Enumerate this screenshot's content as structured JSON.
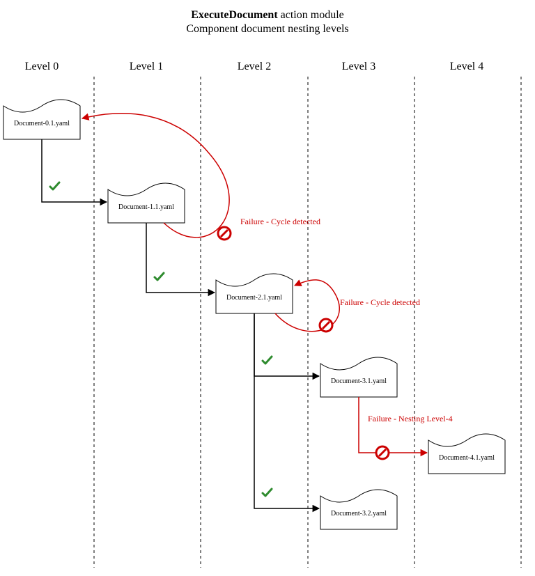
{
  "header": {
    "title_bold": "ExecuteDocument",
    "title_rest": " action module",
    "subtitle": "Component document nesting levels"
  },
  "levels": {
    "l0": "Level 0",
    "l1": "Level 1",
    "l2": "Level 2",
    "l3": "Level 3",
    "l4": "Level 4"
  },
  "docs": {
    "d01": "Document-0.1.yaml",
    "d11": "Document-1.1.yaml",
    "d21": "Document-2.1.yaml",
    "d31": "Document-3.1.yaml",
    "d32": "Document-3.2.yaml",
    "d41": "Document-4.1.yaml"
  },
  "failures": {
    "cycle1": "Failure - Cycle detected",
    "cycle2": "Failure - Cycle detected",
    "nesting4": "Failure - Nesting Level-4"
  },
  "icons": {
    "check": "check-icon",
    "noentry": "no-entry-icon"
  },
  "colors": {
    "ok": "#2e8b2e",
    "fail": "#cc0000",
    "stroke": "#000000"
  }
}
